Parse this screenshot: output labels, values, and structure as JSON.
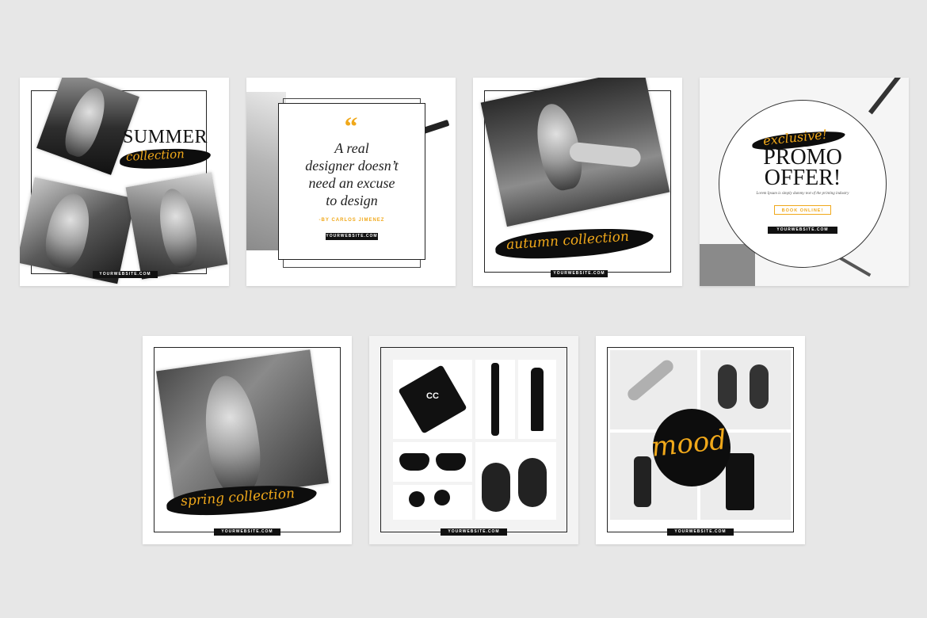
{
  "colors": {
    "accent": "#f0a81a",
    "dark": "#111111",
    "background": "#e7e7e7"
  },
  "card1": {
    "title": "SUMMER",
    "script": "collection",
    "url": "YOURWEBSITE.COM"
  },
  "card2": {
    "quote_mark": "“",
    "quote_lines": [
      "A real",
      "designer doesn’t",
      "need an excuse",
      "to design"
    ],
    "author": "-BY CARLOS JIMENEZ",
    "url": "YOURWEBSITE.COM"
  },
  "card3": {
    "script": "autumn collection",
    "url": "YOURWEBSITE.COM"
  },
  "card4": {
    "script": "exclusive!",
    "title_line1": "PROMO",
    "title_line2": "OFFER!",
    "subtitle": "Lorem Ipsum is simply dummy text of the printing industry",
    "button": "BOOK ONLINE!",
    "url": "YOURWEBSITE.COM"
  },
  "card5": {
    "script": "spring collection",
    "url": "YOURWEBSITE.COM"
  },
  "card6": {
    "url": "YOURWEBSITE.COM",
    "compact_logo": "CC"
  },
  "card7": {
    "script": "mood",
    "url": "YOURWEBSITE.COM"
  }
}
